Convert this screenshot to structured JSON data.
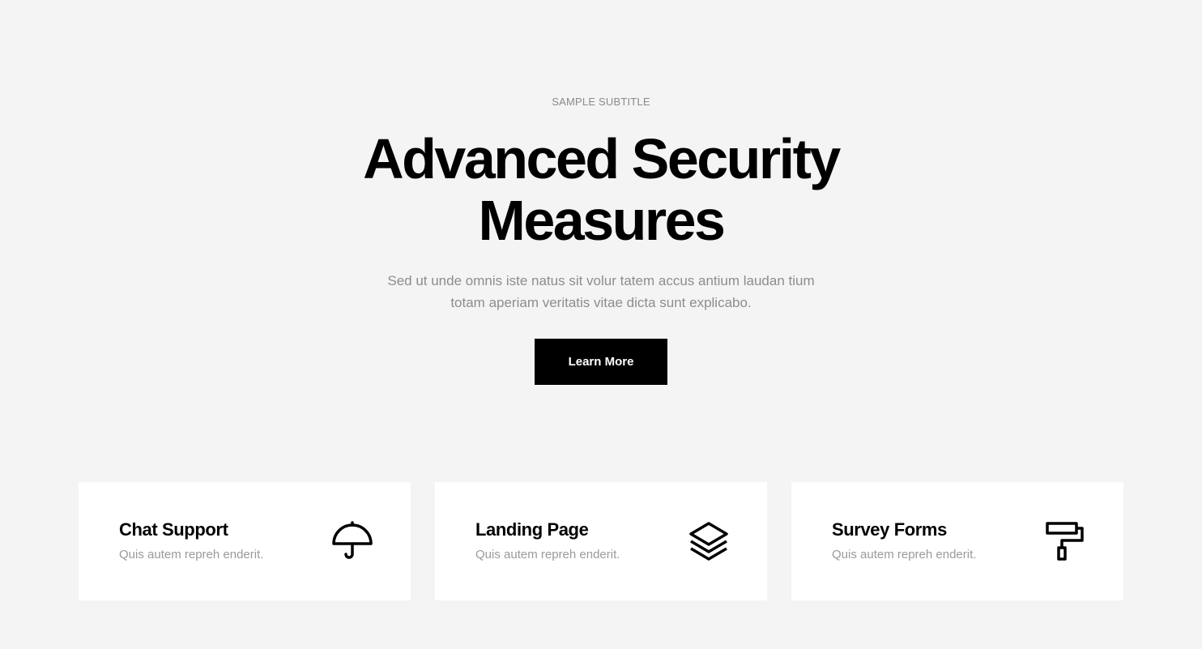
{
  "hero": {
    "subtitle": "SAMPLE SUBTITLE",
    "title_line1": "Advanced Security",
    "title_line2": "Measures",
    "description_line1": "Sed ut unde omnis iste natus sit volur tatem accus antium laudan tium",
    "description_line2": "totam aperiam veritatis vitae dicta sunt explicabo.",
    "button_label": "Learn More"
  },
  "cards": [
    {
      "title": "Chat Support",
      "text": "Quis autem repreh enderit.",
      "icon": "umbrella-icon"
    },
    {
      "title": "Landing Page",
      "text": "Quis autem repreh enderit.",
      "icon": "layers-icon"
    },
    {
      "title": "Survey Forms",
      "text": "Quis autem repreh enderit.",
      "icon": "paint-roller-icon"
    }
  ],
  "colors": {
    "background": "#f4f4f4",
    "button": "#000000",
    "muted_text": "#8d8d8d"
  }
}
